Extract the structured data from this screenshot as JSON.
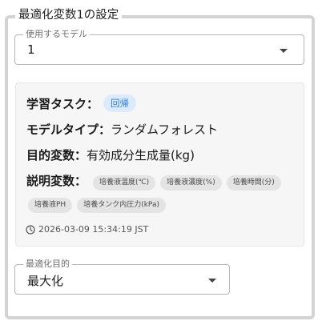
{
  "section": {
    "title": "最適化変数1の設定"
  },
  "model_select": {
    "label": "使用するモデル",
    "value": "1"
  },
  "model_card": {
    "task_label": "学習タスク：",
    "task_badge": "回帰",
    "model_type_label": "モデルタイプ：",
    "model_type_value": "ランダムフォレスト",
    "target_label": "目的変数：",
    "target_value": "有効成分生成量(kg)",
    "features_label": "説明変数：",
    "features": [
      "培養液温度(℃)",
      "培養液濃度(%)",
      "培養時間(分)",
      "培養液PH",
      "培養タンク内圧力(kPa)"
    ],
    "timestamp": "2026-03-09 15:34:19 JST"
  },
  "goal_select": {
    "label": "最適化目的",
    "value": "最大化"
  },
  "icons": {
    "timestamp": "clock-icon",
    "dropdown": "caret-down-icon"
  }
}
